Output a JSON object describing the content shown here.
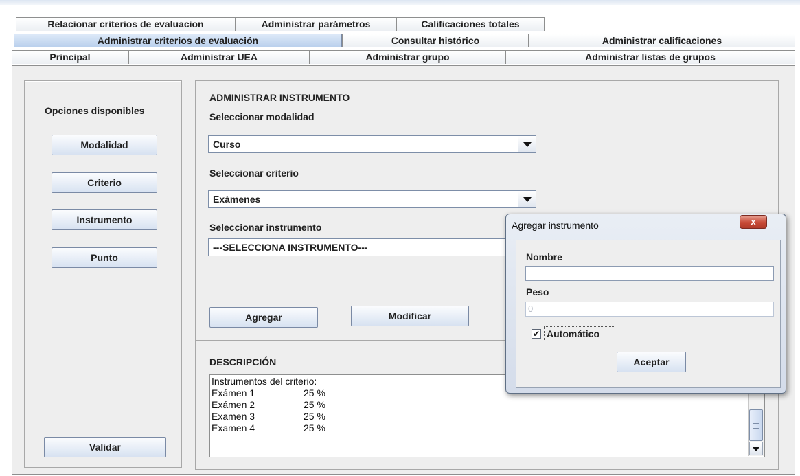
{
  "tabs": {
    "row1": [
      "Relacionar criterios de evaluacion",
      "Administrar parámetros",
      "Calificaciones totales"
    ],
    "row2": [
      "Administrar criterios de evaluación",
      "Consultar histórico",
      "Administrar calificaciones"
    ],
    "row3": [
      "Principal",
      "Administrar UEA",
      "Administrar grupo",
      "Administrar listas de grupos"
    ],
    "selected": "Administrar criterios de evaluación"
  },
  "left_panel": {
    "title": "Opciones disponibles",
    "buttons": [
      "Modalidad",
      "Criterio",
      "Instrumento",
      "Punto"
    ],
    "validate_label": "Validar"
  },
  "main": {
    "heading": "ADMINISTRAR INSTRUMENTO",
    "modalidad_label": "Seleccionar modalidad",
    "modalidad_value": "Curso",
    "criterio_label": "Seleccionar criterio",
    "criterio_value": "Exámenes",
    "instrumento_label": "Seleccionar instrumento",
    "instrumento_value": "---SELECCIONA INSTRUMENTO---",
    "add_label": "Agregar",
    "modify_label": "Modificar"
  },
  "description": {
    "heading": "DESCRIPCIÓN",
    "intro": "Instrumentos del criterio:",
    "items": [
      {
        "name": "Exámen 1",
        "pct": "25 %"
      },
      {
        "name": "Exámen 2",
        "pct": "25 %"
      },
      {
        "name": "Examen 3",
        "pct": "25 %"
      },
      {
        "name": "Examen 4",
        "pct": "25 %"
      }
    ]
  },
  "dialog": {
    "title": "Agregar instrumento",
    "close": "x",
    "nombre_label": "Nombre",
    "nombre_value": "",
    "peso_label": "Peso",
    "peso_value": "0",
    "auto_label": "Automático",
    "auto_checked": true,
    "accept_label": "Aceptar"
  }
}
